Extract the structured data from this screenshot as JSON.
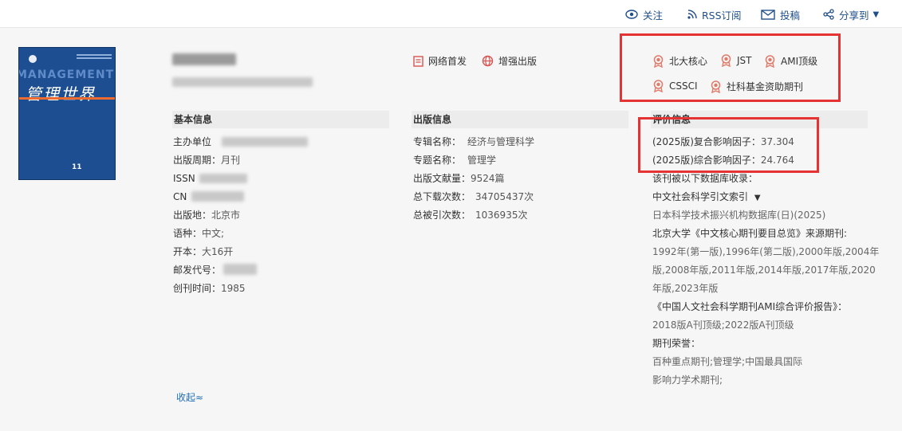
{
  "toolbar": {
    "follow": "关注",
    "rss": "RSS订阅",
    "submit": "投稿",
    "share": "分享到"
  },
  "journal": {
    "cover_en": "MANAGEMENT",
    "cover_cn": "管理世界",
    "cover_issue": "11",
    "first_online": "网络首发",
    "enhanced": "增强出版"
  },
  "badges": [
    "北大核心",
    "JST",
    "AMI顶级",
    "CSSCI",
    "社科基金资助期刊"
  ],
  "basic": {
    "title": "基本信息",
    "sponsor_label": "主办单位",
    "cycle": "出版周期：",
    "cycle_value": "月刊",
    "issn_label": "ISSN",
    "cn_label": "CN",
    "place_label": "出版地：",
    "place_value": "北京市",
    "lang_label": "语种：",
    "lang_value": "中文;",
    "format_label": "开本：",
    "format_value": "大16开",
    "postal_label": "邮发代号：",
    "founded_label": "创刊时间：",
    "founded_value": "1985"
  },
  "publish": {
    "title": "出版信息",
    "subject_label": "专辑名称：",
    "subject_value": "经济与管理科学",
    "topic_label": "专题名称：",
    "topic_value": "管理学",
    "docs_label": "出版文献量：",
    "docs_value": "9524篇",
    "downloads_label": "总下载次数：",
    "downloads_value": "34705437次",
    "citations_label": "总被引次数：",
    "citations_value": "1036935次"
  },
  "eval": {
    "title": "评价信息",
    "composite_label": "(2025版)复合影响因子：",
    "composite_value": "37.304",
    "comprehensive_label": "(2025版)综合影响因子：",
    "comprehensive_value": "24.764",
    "db_intro": "该刊被以下数据库收录：",
    "db1": "中文社会科学引文索引",
    "db2": "日本科学技术振兴机构数据库(日)(2025)",
    "pku_title": "北京大学《中文核心期刊要目总览》来源期刊:",
    "pku_line1": "1992年(第一版),1996年(第二版),2000年版,2004年",
    "pku_line2": "版,2008年版,2011年版,2014年版,2017年版,2020",
    "pku_line3": "年版,2023年版",
    "ami_title": "《中国人文社会科学期刊AMI综合评价报告》：",
    "ami_value": "2018版A刊顶级;2022版A刊顶级",
    "honor_title": "期刊荣誉：",
    "honor_line1": "百种重点期刊;管理学;中国最具国际",
    "honor_line2": "影响力学术期刊;"
  },
  "collapse": "收起≈",
  "colors": {
    "accent": "#1f4f8b",
    "highlight": "#e53333",
    "badge": "#e07a6a"
  }
}
